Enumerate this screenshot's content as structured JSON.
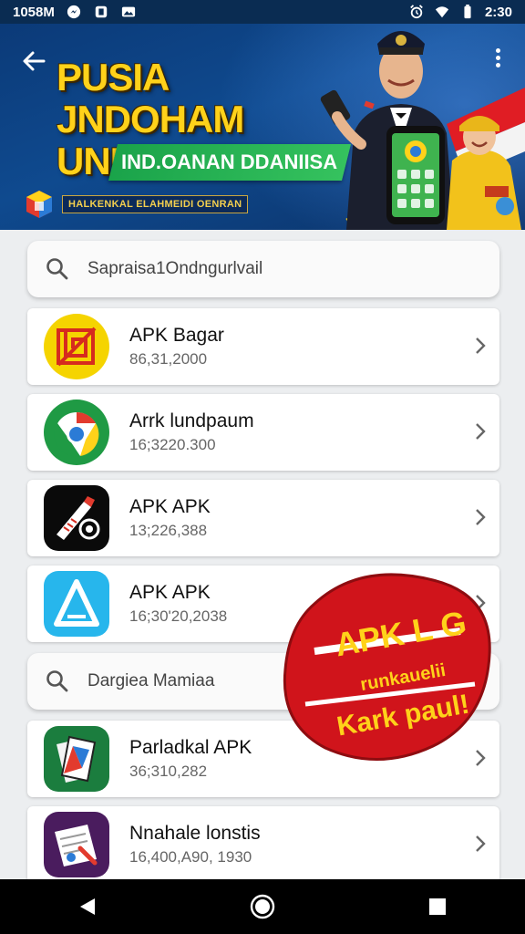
{
  "status_bar": {
    "left_text": "1058M",
    "time": "2:30",
    "left_icons": [
      "messenger-icon",
      "notification-icon",
      "photo-icon"
    ],
    "right_icons": [
      "alarm-icon",
      "wifi-icon",
      "battery-icon"
    ]
  },
  "banner": {
    "title_line1": "PUSIA JNDOHAM",
    "title_line2": "UNDONESIA",
    "subtitle": "IND.OANAN DDANIISA",
    "tagline": "HALKENKAL ELAHMEIDI OENRAN",
    "accent": "#ffd21a",
    "green": "#1aa34a"
  },
  "search_top": {
    "placeholder": "Sapraisa1Ondngurlvail"
  },
  "apps": [
    {
      "name": "APK Bagar",
      "meta": "86,31,2000",
      "icon": "maze-app-icon",
      "bg": "#f5d400"
    },
    {
      "name": "Arrk lundpaum",
      "meta": "16;3220.300",
      "icon": "chrome-style-app-icon",
      "bg": "#1f9a44"
    },
    {
      "name": "APK APK",
      "meta": "13;226,388",
      "icon": "tools-app-icon",
      "bg": "#0a0a0a"
    },
    {
      "name": "APK APK",
      "meta": "16;30'20,2038",
      "icon": "triangle-app-icon",
      "bg": "#27b6ec"
    }
  ],
  "search_mid": {
    "placeholder": "Dargiea Mamiaa"
  },
  "apps2": [
    {
      "name": "Parladkal APK",
      "meta": "36;310,282",
      "icon": "documents-app-icon",
      "bg": "#1b7d3e"
    },
    {
      "name": "Nnahale lonstis",
      "meta": "16,400,A90, 1930",
      "icon": "stationery-app-icon",
      "bg": "#4a1c5e"
    }
  ],
  "sticker": {
    "line1": "APK L G",
    "line2": "runkauelii",
    "line3": "Kark paul!",
    "color": "#d0141b"
  }
}
